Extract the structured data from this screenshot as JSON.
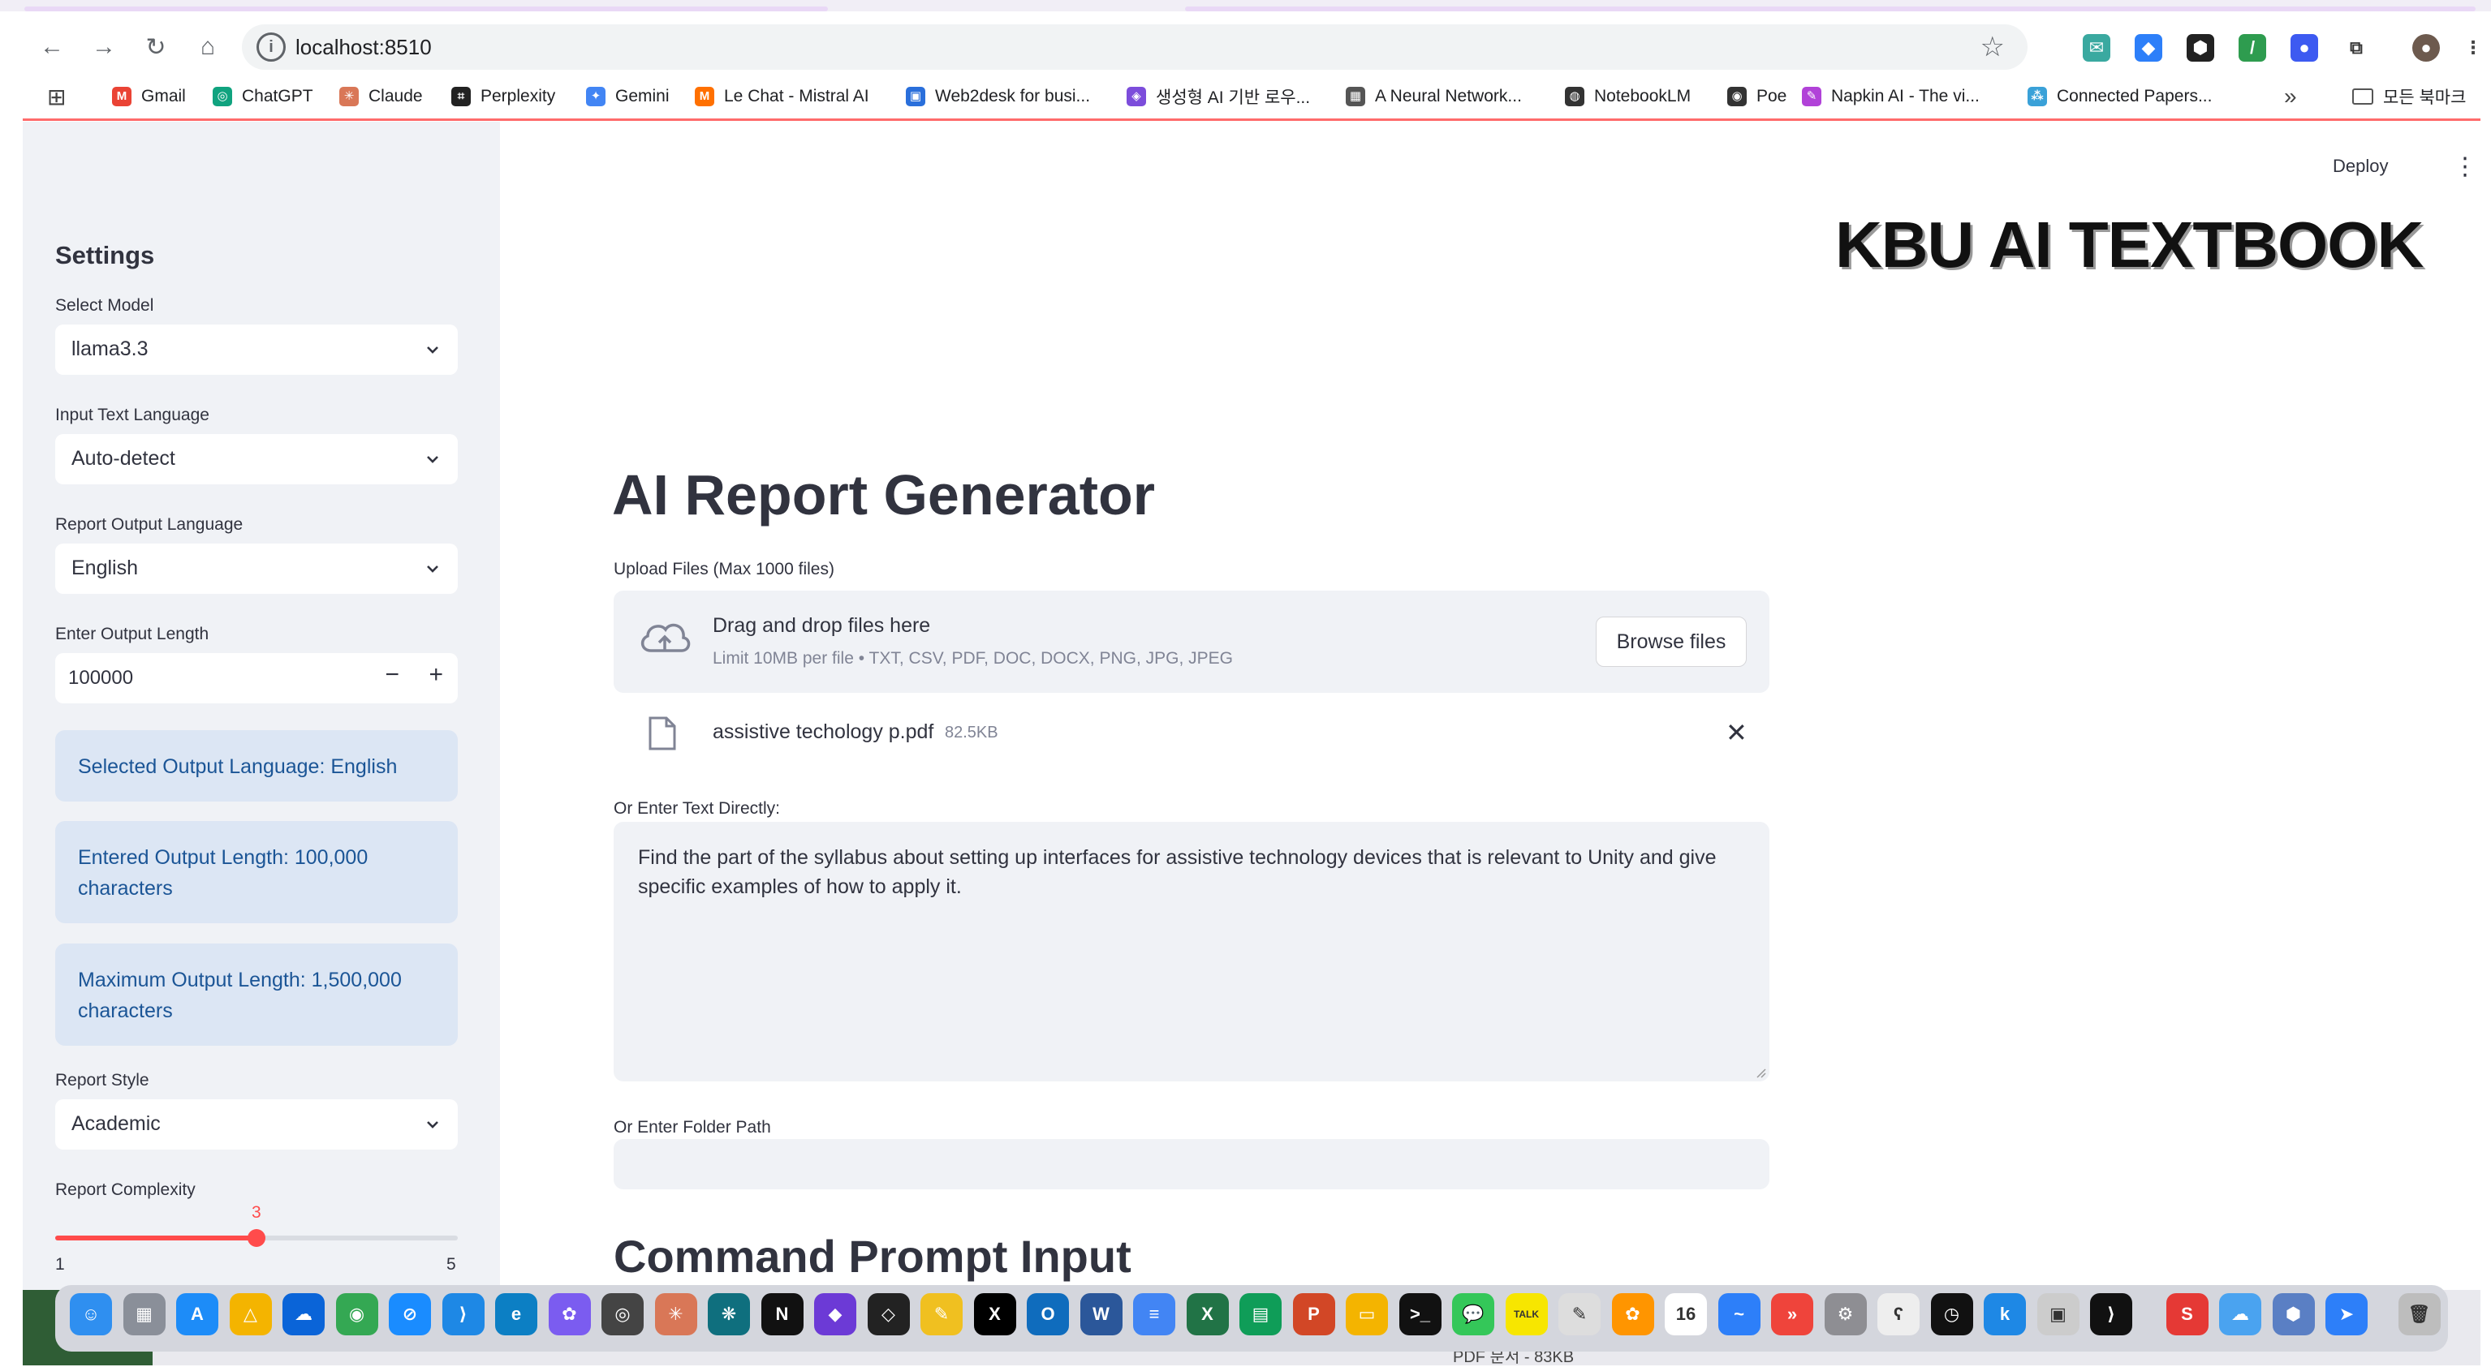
{
  "browser": {
    "url": "localhost:8510",
    "bookmarks": [
      {
        "label": "Gmail",
        "color": "#ea4335",
        "glyph": "M"
      },
      {
        "label": "ChatGPT",
        "color": "#10a37f",
        "glyph": "◎"
      },
      {
        "label": "Claude",
        "color": "#d97757",
        "glyph": "✳"
      },
      {
        "label": "Perplexity",
        "color": "#222222",
        "glyph": "⌗"
      },
      {
        "label": "Gemini",
        "color": "#4285f4",
        "glyph": "✦"
      },
      {
        "label": "Le Chat - Mistral AI",
        "color": "#ff7000",
        "glyph": "M"
      },
      {
        "label": "Web2desk for busi...",
        "color": "#2a6fdb",
        "glyph": "▣"
      },
      {
        "label": "생성형 AI 기반 로우...",
        "color": "#7c4ddb",
        "glyph": "◈"
      },
      {
        "label": "A Neural Network...",
        "color": "#555555",
        "glyph": "▦"
      },
      {
        "label": "NotebookLM",
        "color": "#333333",
        "glyph": "◍"
      },
      {
        "label": "Poe",
        "color": "#333333",
        "glyph": "◉"
      },
      {
        "label": "Napkin AI - The vi...",
        "color": "#b142d8",
        "glyph": "✎"
      },
      {
        "label": "Connected Papers...",
        "color": "#3aa1d8",
        "glyph": "⁂"
      }
    ],
    "bookmarks_overflow": "»",
    "all_bookmarks": "모든 북마크"
  },
  "sidebar": {
    "title": "Settings",
    "select_model": {
      "label": "Select Model",
      "value": "llama3.3"
    },
    "input_language": {
      "label": "Input Text Language",
      "value": "Auto-detect"
    },
    "output_language": {
      "label": "Report Output Language",
      "value": "English"
    },
    "output_length": {
      "label": "Enter Output Length",
      "value": "100000",
      "minus": "−",
      "plus": "+"
    },
    "info_boxes": [
      "Selected Output Language: English",
      "Entered Output Length: 100,000 characters",
      "Maximum Output Length: 1,500,000 characters"
    ],
    "report_style": {
      "label": "Report Style",
      "value": "Academic"
    },
    "report_complexity": {
      "label": "Report Complexity",
      "value": 3,
      "min": 1,
      "max": 5
    }
  },
  "header": {
    "deploy": "Deploy",
    "menu": "⋮",
    "logo": "KBU AI TEXTBOOK"
  },
  "main": {
    "title": "AI Report Generator",
    "upload": {
      "label": "Upload Files (Max 1000 files)",
      "drop_title": "Drag and drop files here",
      "drop_sub": "Limit 10MB per file • TXT, CSV, PDF, DOC, DOCX, PNG, JPG, JPEG",
      "browse": "Browse files"
    },
    "file": {
      "name": "assistive techology p.pdf",
      "size": "82.5KB",
      "remove": "✕"
    },
    "text_input": {
      "label": "Or Enter Text Directly:",
      "value": "Find the part of the syllabus about setting up interfaces for assistive technology devices that is relevant to Unity and give specific examples of how to apply it."
    },
    "folder": {
      "label": "Or Enter Folder Path",
      "value": ""
    },
    "section_title": "Command Prompt Input"
  },
  "dock": {
    "caption": "PDF 문서 - 83KB",
    "apps": [
      {
        "name": "finder",
        "color": "#2f8ff0",
        "glyph": "☺"
      },
      {
        "name": "launchpad",
        "color": "#8a8f99",
        "glyph": "▦"
      },
      {
        "name": "app-store",
        "color": "#1d8cf8",
        "glyph": "A"
      },
      {
        "name": "google-drive",
        "color": "#f4b400",
        "glyph": "△"
      },
      {
        "name": "onedrive",
        "color": "#0a64d8",
        "glyph": "☁"
      },
      {
        "name": "chrome",
        "color": "#34a853",
        "glyph": "◉"
      },
      {
        "name": "safari",
        "color": "#1a8cff",
        "glyph": "⊘"
      },
      {
        "name": "vscode",
        "color": "#1e88e5",
        "glyph": "⟩"
      },
      {
        "name": "edge",
        "color": "#0c7fc4",
        "glyph": "e"
      },
      {
        "name": "copilot",
        "color": "#7b5cf0",
        "glyph": "✿"
      },
      {
        "name": "chatgpt",
        "color": "#444444",
        "glyph": "◎"
      },
      {
        "name": "claude",
        "color": "#d97757",
        "glyph": "✳"
      },
      {
        "name": "butterfly",
        "color": "#0f6f7e",
        "glyph": "❋"
      },
      {
        "name": "notion",
        "color": "#111111",
        "glyph": "N"
      },
      {
        "name": "arc",
        "color": "#6c3ad6",
        "glyph": "◆"
      },
      {
        "name": "cursor",
        "color": "#222222",
        "glyph": "◇"
      },
      {
        "name": "brush",
        "color": "#f0c020",
        "glyph": "✎"
      },
      {
        "name": "x",
        "color": "#000000",
        "glyph": "X"
      },
      {
        "name": "outlook",
        "color": "#0f6cbd",
        "glyph": "O"
      },
      {
        "name": "word",
        "color": "#2b579a",
        "glyph": "W"
      },
      {
        "name": "docs",
        "color": "#4285f4",
        "glyph": "≡"
      },
      {
        "name": "excel",
        "color": "#217346",
        "glyph": "X"
      },
      {
        "name": "sheets",
        "color": "#0f9d58",
        "glyph": "▤"
      },
      {
        "name": "powerpoint",
        "color": "#d24726",
        "glyph": "P"
      },
      {
        "name": "slides",
        "color": "#f4b400",
        "glyph": "▭"
      },
      {
        "name": "terminal",
        "color": "#111111",
        "glyph": ">_"
      },
      {
        "name": "messages",
        "color": "#34c759",
        "glyph": "💬"
      },
      {
        "name": "kakaotalk",
        "color": "#f7e600",
        "glyph": "TALK"
      },
      {
        "name": "textedit",
        "color": "#dddddd",
        "glyph": "✎"
      },
      {
        "name": "photos",
        "color": "#ff9500",
        "glyph": "✿"
      },
      {
        "name": "calendar",
        "color": "#ffffff",
        "glyph": "16"
      },
      {
        "name": "freeform",
        "color": "#2d7ff9",
        "glyph": "~"
      },
      {
        "name": "anydesk",
        "color": "#ef443b",
        "glyph": "»"
      },
      {
        "name": "settings",
        "color": "#8e8e93",
        "glyph": "⚙"
      },
      {
        "name": "bear",
        "color": "#eeeeee",
        "glyph": "ʕ"
      },
      {
        "name": "clock",
        "color": "#111111",
        "glyph": "◷"
      },
      {
        "name": "k-app",
        "color": "#1e88e5",
        "glyph": "k"
      },
      {
        "name": "preview",
        "color": "#cccccc",
        "glyph": "▣"
      },
      {
        "name": "xcode-tool",
        "color": "#111111",
        "glyph": "⟩"
      },
      {
        "name": "s-app",
        "color": "#e53935",
        "glyph": "S"
      },
      {
        "name": "icloud",
        "color": "#4aa3f0",
        "glyph": "☁"
      },
      {
        "name": "hex-app",
        "color": "#5a7fc4",
        "glyph": "⬢"
      },
      {
        "name": "arrow-app",
        "color": "#2d7ff9",
        "glyph": "➤"
      },
      {
        "name": "trash",
        "color": "#bdbdbd",
        "glyph": "🗑"
      }
    ]
  },
  "colors": {
    "accent": "#ff4b4b",
    "sidebar_bg": "#f0f2f6",
    "info_bg": "#dce6f4",
    "info_text": "#1b5596"
  }
}
